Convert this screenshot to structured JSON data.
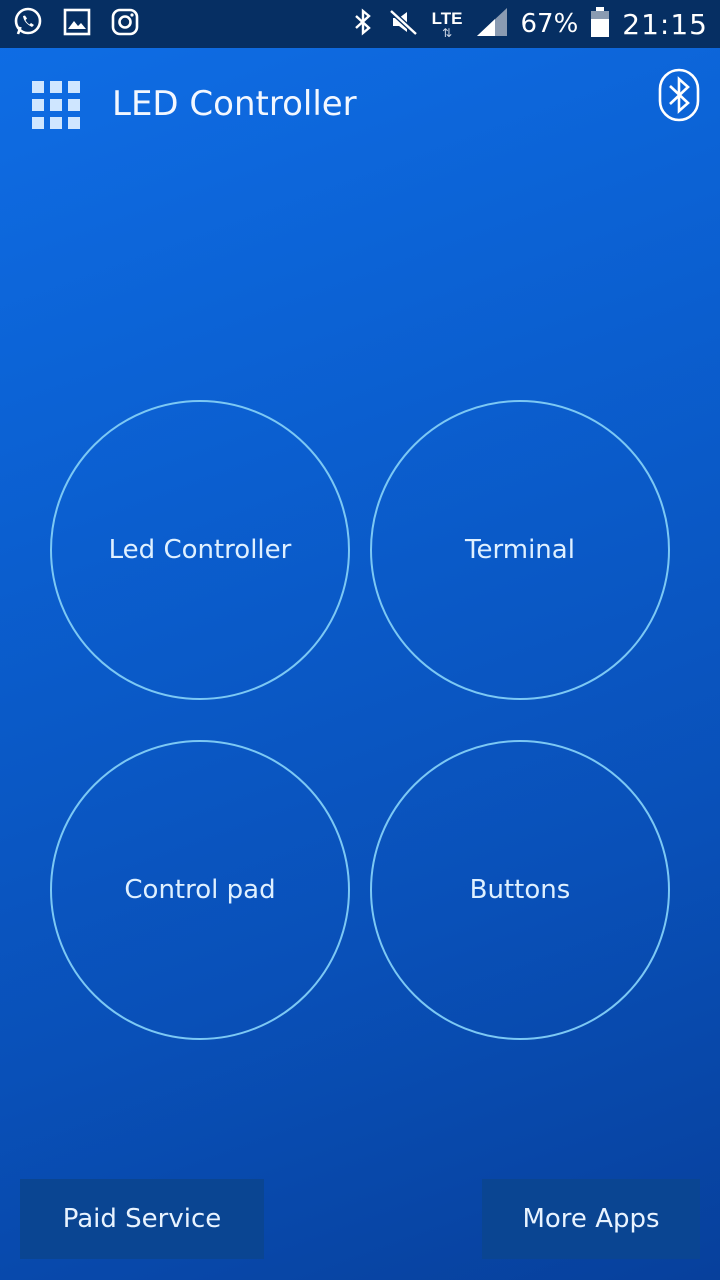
{
  "status_bar": {
    "icons_left": [
      "whatsapp-icon",
      "gallery-icon",
      "instagram-icon"
    ],
    "network": "LTE",
    "battery": "67%",
    "time": "21:15"
  },
  "app_bar": {
    "title": "LED Controller"
  },
  "menu": {
    "items": [
      "Led Controller",
      "Terminal",
      "Control pad",
      "Buttons"
    ]
  },
  "footer": {
    "paid_label": "Paid Service",
    "more_label": "More Apps"
  },
  "colors": {
    "background": "#0b5fd0",
    "status_bar": "#062f63",
    "circle_border": "#7cc8f4",
    "footer_button": "#0a4592"
  }
}
